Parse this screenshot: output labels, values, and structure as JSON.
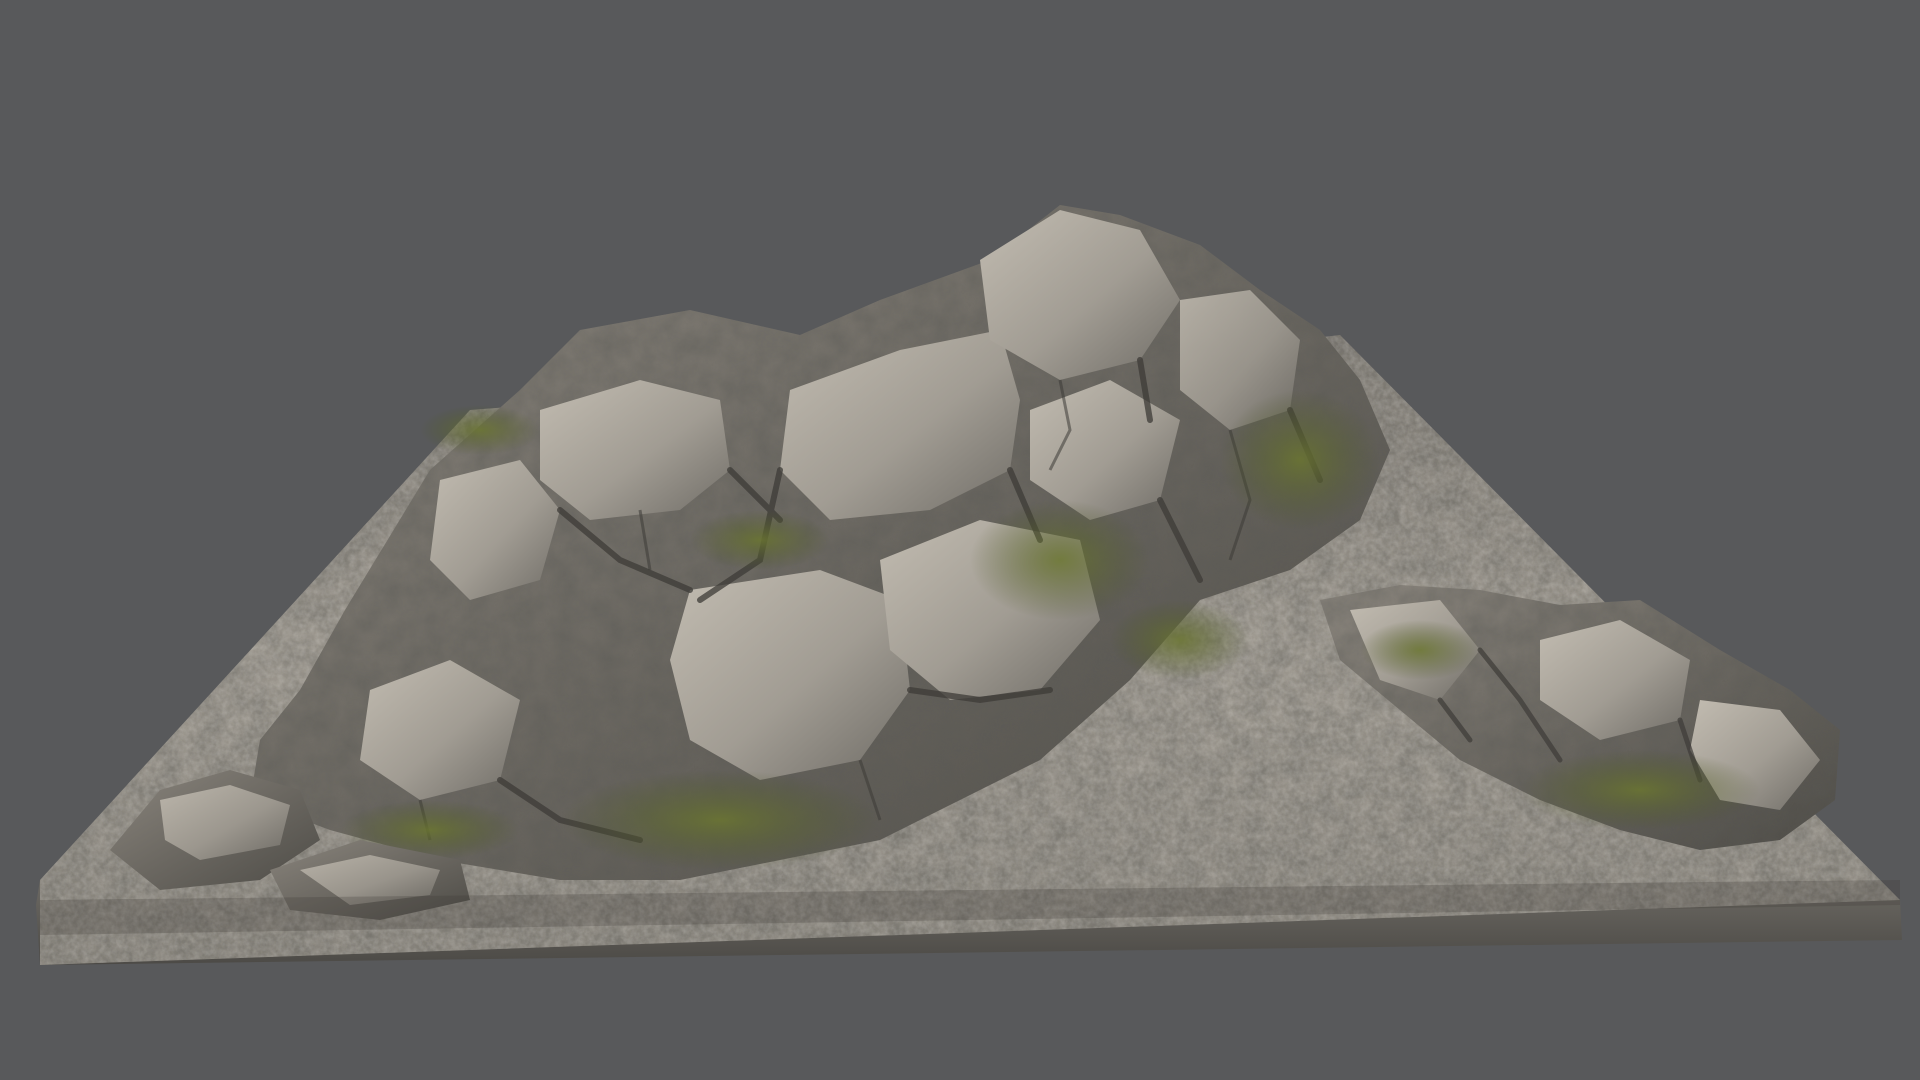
{
  "scene": {
    "subject": "rock-terrain-model",
    "colors": {
      "background": "#58595b",
      "stone_light": "#b7b1a6",
      "stone_mid": "#8c8880",
      "stone_dark": "#4a4843",
      "moss": "#5f6b2a",
      "moss_dark": "#3c4420"
    }
  }
}
